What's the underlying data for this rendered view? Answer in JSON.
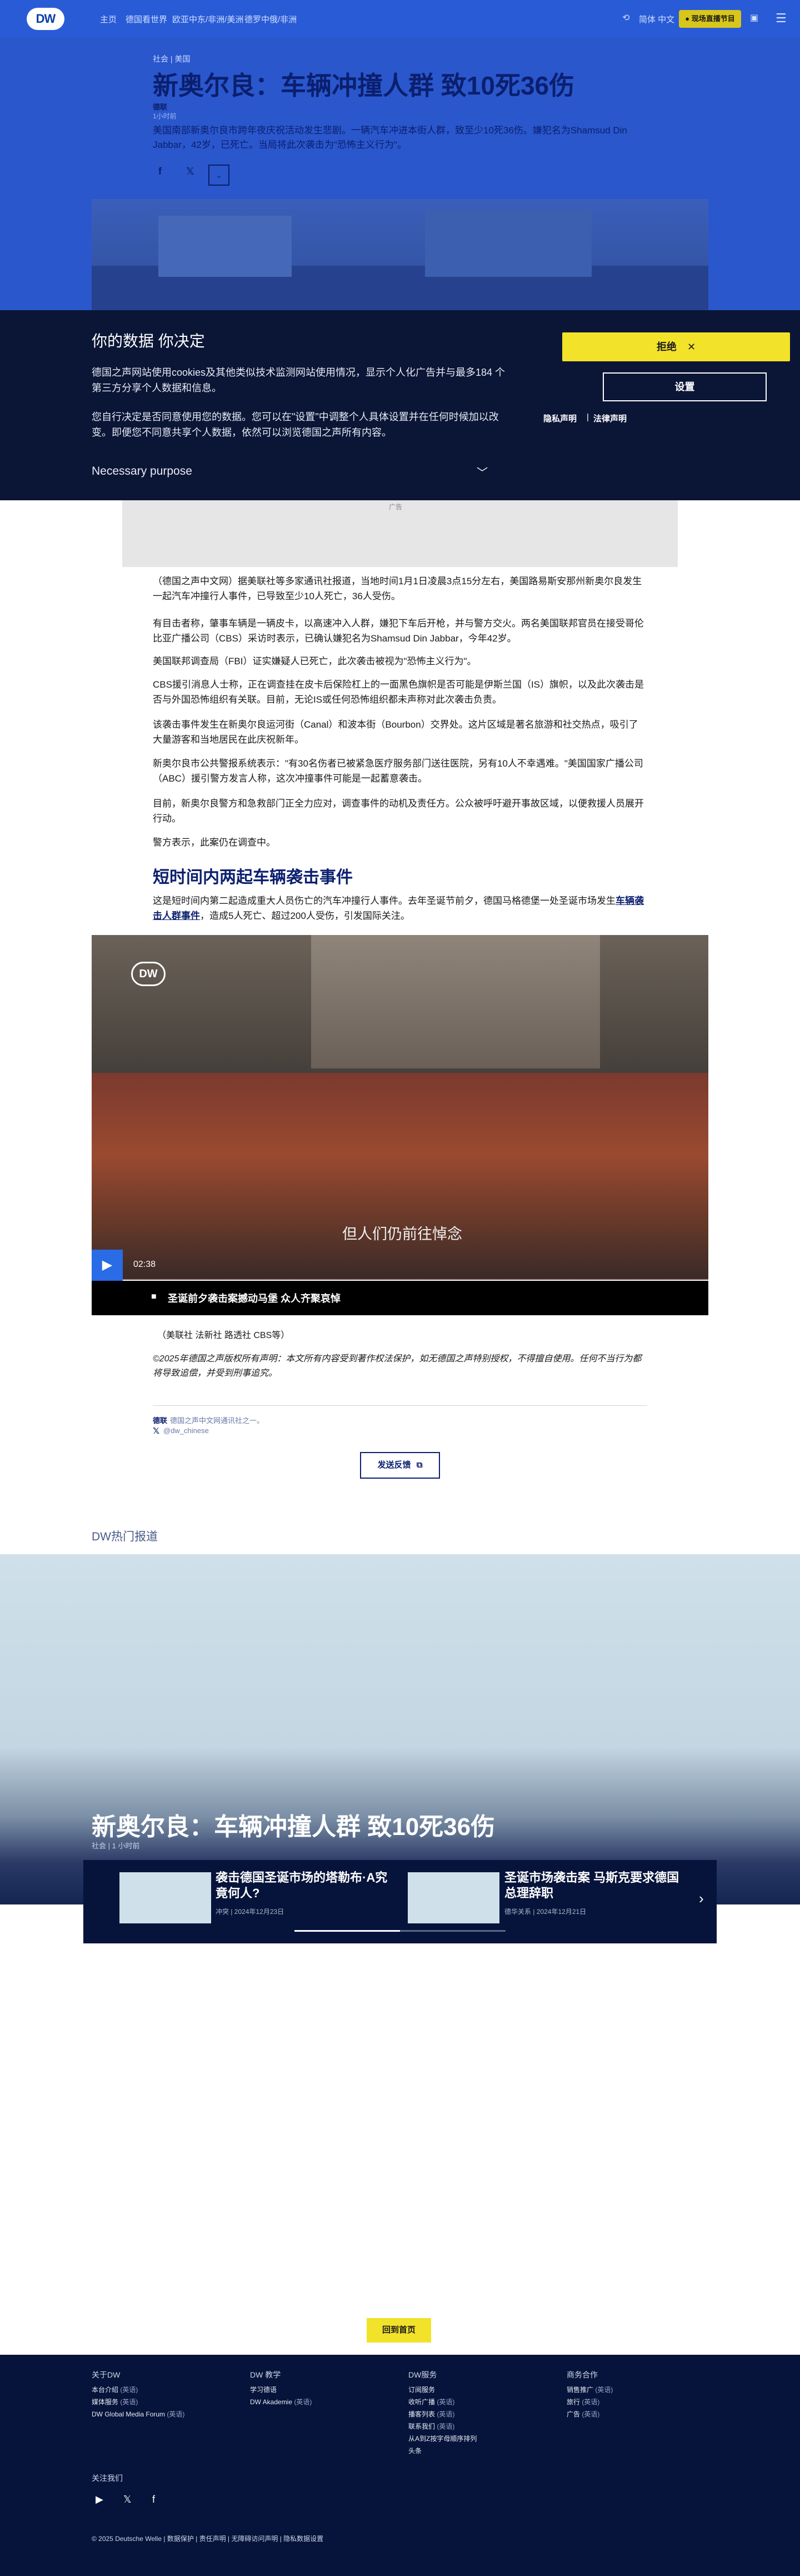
{
  "header": {
    "logo": "DW",
    "nav": [
      "主页",
      "德国看世界",
      "欧亚中东/非洲/美洲",
      "德罗中俄/非洲"
    ],
    "lang": "简体 中文",
    "live_button": "● 现场直播节目",
    "menu_icon": "menu-icon",
    "account_icon": "user-icon"
  },
  "article": {
    "breadcrumb": "社会 | 美国",
    "title": "新奥尔良：车辆冲撞人群 致10死36伤",
    "byline_name": "德联",
    "byline_date": "1小时前",
    "lead": "美国南部新奥尔良市跨年夜庆祝活动发生悲剧。一辆汽车冲进本街人群，致至少10死36伤。嫌犯名为Shamsud Din Jabbar，42岁，已死亡。当局将此次袭击为\"恐怖主义行为\"。",
    "paragraphs": [
      "（德国之声中文网）据美联社等多家通讯社报道，当地时间1月1日凌晨3点15分左右，美国路易斯安那州新奥尔良发生一起汽车冲撞行人事件，已导致至少10人死亡，36人受伤。",
      "有目击者称，肇事车辆是一辆皮卡，以高速冲入人群，嫌犯下车后开枪，并与警方交火。两名美国联邦官员在接受哥伦比亚广播公司（CBS）采访时表示，已确认嫌犯名为Shamsud Din Jabbar，今年42岁。",
      "美国联邦调查局（FBI）证实嫌疑人已死亡，此次袭击被视为\"恐怖主义行为\"。",
      "CBS援引消息人士称，正在调查挂在皮卡后保险杠上的一面黑色旗帜是否可能是伊斯兰国（IS）旗帜，以及此次袭击是否与外国恐怖组织有关联。目前，无论IS或任何恐怖组织都未声称对此次袭击负责。",
      "该袭击事件发生在新奥尔良运河街（Canal）和波本街（Bourbon）交界处。这片区域是著名旅游和社交热点，吸引了大量游客和当地居民在此庆祝新年。",
      "新奥尔良市公共警报系统表示：\"有30名伤者已被紧急医疗服务部门送往医院，另有10人不幸遇难。\"美国国家广播公司（ABC）援引警方发言人称，这次冲撞事件可能是一起蓄意袭击。",
      "目前，新奥尔良警方和急救部门正全力应对，调查事件的动机及责任方。公众被呼吁避开事故区域，以便救援人员展开行动。",
      "警方表示，此案仍在调查中。"
    ],
    "subhead": "短时间内两起车辆袭击事件",
    "intro2_before": "这是短时间内第二起造成重大人员伤亡的汽车冲撞行人事件。去年圣诞节前夕，德国马格德堡一处圣诞市场发生",
    "intro2_link": "车辆袭击人群事件",
    "intro2_after": "，造成5人死亡、超过200人受伤，引发国际关注。",
    "video": {
      "logo": "DW",
      "subtitle": "但人们仍前往悼念",
      "duration": "02:38",
      "caption": "圣诞前夕袭击案撼动马堡 众人齐聚哀悼"
    },
    "credit": "（美联社 法新社 路透社 CBS等）",
    "copyright": "©2025年德国之声版权所有声明：本文所有内容受到著作权法保护，如无德国之声特别授权，不得擅自使用。任何不当行为都将导致追偿，并受到刑事追究。",
    "source_name": "德联",
    "source_text": "德国之声中文网通讯社之一。",
    "source_handle": "@dw_chinese",
    "feedback": "发送反馈"
  },
  "cookie": {
    "title": "你的数据 你决定",
    "p1": "德国之声网站使用cookies及其他类似技术监测网站使用情况，显示个人化广告并与最多184 个第三方分享个人数据和信息。",
    "p2": "您自行决定是否同意使用您的数据。您可以在\"设置\"中调整个人具体设置并在任何时候加以改变。即便您不同意共享个人数据，依然可以浏览德国之声所有内容。",
    "purpose": "Necessary purpose",
    "reject": "拒绝",
    "settings": "设置",
    "privacy": "隐私声明",
    "legal": "法律声明"
  },
  "ad_label": "广告",
  "hot": {
    "section_title": "DW热门报道",
    "headline": "新奥尔良：车辆冲撞人群 致10死36伤",
    "meta": "社会 | 1 小时前",
    "cards": [
      {
        "title": "袭击德国圣诞市场的塔勒布·A究竟何人?",
        "meta": "冲突 | 2024年12月23日"
      },
      {
        "title": "圣诞市场袭击案 马斯克要求德国总理辞职",
        "meta": "德华关系 | 2024年12月21日"
      }
    ]
  },
  "back_to_top": "回到首页",
  "footer": {
    "columns": [
      {
        "head": "关于DW",
        "links": [
          [
            "本台介绍",
            "(英语)"
          ],
          [
            "媒体服务",
            "(英语)"
          ],
          [
            "DW Global Media Forum",
            "(英语)"
          ]
        ]
      },
      {
        "head": "DW 教学",
        "links": [
          [
            "学习德语",
            ""
          ],
          [
            "DW Akademie",
            "(英语)"
          ]
        ]
      },
      {
        "head": "DW服务",
        "links": [
          [
            "订阅服务",
            ""
          ],
          [
            "收听广播",
            "(英语)"
          ],
          [
            "播客列表",
            "(英语)"
          ],
          [
            "联系我们",
            "(英语)"
          ],
          [
            "从A到Z按字母顺序排列",
            ""
          ],
          [
            "头条",
            ""
          ]
        ]
      },
      {
        "head": "商务合作",
        "links": [
          [
            "销售推广",
            "(英语)"
          ],
          [
            "旅行",
            "(英语)"
          ],
          [
            "广告",
            "(英语)"
          ]
        ]
      }
    ],
    "follow": "关注我们",
    "copyright": "© 2025 Deutsche Welle  |  数据保护  |  责任声明  |  无障碍访问声明  |  隐私数据设置"
  }
}
